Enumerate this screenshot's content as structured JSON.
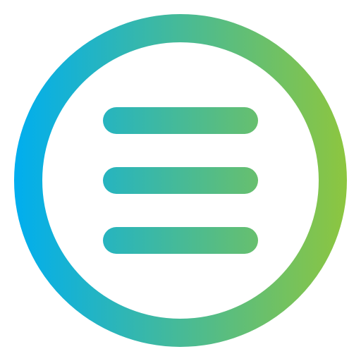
{
  "icon": {
    "name": "menu-icon",
    "style": "circular hamburger menu",
    "gradient": {
      "start": "#00AEEF",
      "end": "#8DC63F"
    }
  }
}
